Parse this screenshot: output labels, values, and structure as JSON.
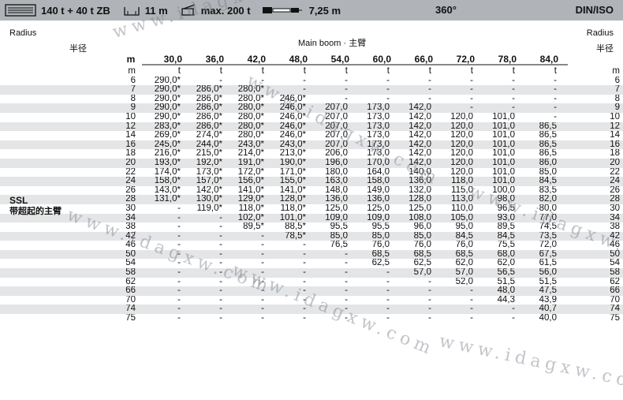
{
  "topbar": {
    "counterweight": "140 t + 40 t ZB",
    "radius": "11 m",
    "capacity": "max. 200 t",
    "width": "7,25 m",
    "slew": "360°",
    "standard": "DIN/ISO"
  },
  "header": {
    "radius_left_en": "Radius",
    "radius_left_cn": "半径",
    "main_boom": "Main boom · 主臂",
    "radius_right_en": "Radius",
    "radius_right_cn": "半径",
    "m_label": "m",
    "unit_m": "m",
    "unit_t": "t",
    "boom_lengths": [
      "30,0",
      "36,0",
      "42,0",
      "48,0",
      "54,0",
      "60,0",
      "66,0",
      "72,0",
      "78,0",
      "84,0"
    ]
  },
  "config": {
    "code": "SSL",
    "desc_cn": "带超起的主臂"
  },
  "watermark": "www.idagxw.com",
  "rows": [
    {
      "r": "6",
      "v": [
        "290,0*",
        "-",
        "-",
        "-",
        "-",
        "-",
        "-",
        "-",
        "-",
        "-"
      ]
    },
    {
      "r": "7",
      "v": [
        "290,0*",
        "286,0*",
        "280,0*",
        "-",
        "-",
        "-",
        "-",
        "-",
        "-",
        "-"
      ]
    },
    {
      "r": "8",
      "v": [
        "290,0*",
        "286,0*",
        "280,0*",
        "246,0*",
        "-",
        "-",
        "-",
        "-",
        "-",
        "-"
      ]
    },
    {
      "r": "9",
      "v": [
        "290,0*",
        "286,0*",
        "280,0*",
        "246,0*",
        "207,0",
        "173,0",
        "142,0",
        "-",
        "-",
        "-"
      ]
    },
    {
      "r": "10",
      "v": [
        "290,0*",
        "286,0*",
        "280,0*",
        "246,0*",
        "207,0",
        "173,0",
        "142,0",
        "120,0",
        "101,0",
        "-"
      ]
    },
    {
      "r": "12",
      "v": [
        "283,0*",
        "286,0*",
        "280,0*",
        "246,0*",
        "207,0",
        "173,0",
        "142,0",
        "120,0",
        "101,0",
        "86,5"
      ]
    },
    {
      "r": "14",
      "v": [
        "269,0*",
        "274,0*",
        "280,0*",
        "246,0*",
        "207,0",
        "173,0",
        "142,0",
        "120,0",
        "101,0",
        "86,5"
      ]
    },
    {
      "r": "16",
      "v": [
        "245,0*",
        "244,0*",
        "243,0*",
        "243,0*",
        "207,0",
        "173,0",
        "142,0",
        "120,0",
        "101,0",
        "86,5"
      ]
    },
    {
      "r": "18",
      "v": [
        "216,0*",
        "215,0*",
        "214,0*",
        "213,0*",
        "206,0",
        "173,0",
        "142,0",
        "120,0",
        "101,0",
        "86,5"
      ]
    },
    {
      "r": "20",
      "v": [
        "193,0*",
        "192,0*",
        "191,0*",
        "190,0*",
        "196,0",
        "170,0",
        "142,0",
        "120,0",
        "101,0",
        "86,0"
      ]
    },
    {
      "r": "22",
      "v": [
        "174,0*",
        "173,0*",
        "172,0*",
        "171,0*",
        "180,0",
        "164,0",
        "140,0",
        "120,0",
        "101,0",
        "85,0"
      ]
    },
    {
      "r": "24",
      "v": [
        "158,0*",
        "157,0*",
        "156,0*",
        "155,0*",
        "163,0",
        "158,0",
        "136,0",
        "118,0",
        "101,0",
        "84,5"
      ]
    },
    {
      "r": "26",
      "v": [
        "143,0*",
        "142,0*",
        "141,0*",
        "141,0*",
        "148,0",
        "149,0",
        "132,0",
        "115,0",
        "100,0",
        "83,5"
      ]
    },
    {
      "r": "28",
      "v": [
        "131,0*",
        "130,0*",
        "129,0*",
        "128,0*",
        "136,0",
        "136,0",
        "128,0",
        "113,0",
        "98,0",
        "82,0"
      ]
    },
    {
      "r": "30",
      "v": [
        "-",
        "119,0*",
        "118,0*",
        "118,0*",
        "125,0",
        "125,0",
        "125,0",
        "110,0",
        "96,5",
        "80,0"
      ]
    },
    {
      "r": "34",
      "v": [
        "-",
        "-",
        "102,0*",
        "101,0*",
        "109,0",
        "109,0",
        "108,0",
        "105,0",
        "93,0",
        "77,0"
      ]
    },
    {
      "r": "38",
      "v": [
        "-",
        "-",
        "89,5*",
        "88,5*",
        "95,5",
        "95,5",
        "96,0",
        "95,0",
        "89,5",
        "74,5"
      ]
    },
    {
      "r": "42",
      "v": [
        "-",
        "-",
        "-",
        "78,5*",
        "85,0",
        "85,0",
        "85,0",
        "84,5",
        "84,5",
        "73,5"
      ]
    },
    {
      "r": "46",
      "v": [
        "-",
        "-",
        "-",
        "-",
        "76,5",
        "76,0",
        "76,0",
        "76,0",
        "75,5",
        "72,0"
      ]
    },
    {
      "r": "50",
      "v": [
        "-",
        "-",
        "-",
        "-",
        "-",
        "68,5",
        "68,5",
        "68,5",
        "68,0",
        "67,5"
      ]
    },
    {
      "r": "54",
      "v": [
        "-",
        "-",
        "-",
        "-",
        "-",
        "62,5",
        "62,5",
        "62,0",
        "62,0",
        "61,5"
      ]
    },
    {
      "r": "58",
      "v": [
        "-",
        "-",
        "-",
        "-",
        "-",
        "-",
        "57,0",
        "57,0",
        "56,5",
        "56,0"
      ]
    },
    {
      "r": "62",
      "v": [
        "-",
        "-",
        "-",
        "-",
        "-",
        "-",
        "-",
        "52,0",
        "51,5",
        "51,5"
      ]
    },
    {
      "r": "66",
      "v": [
        "-",
        "-",
        "-",
        "-",
        "-",
        "-",
        "-",
        "-",
        "48,0",
        "47,5"
      ]
    },
    {
      "r": "70",
      "v": [
        "-",
        "-",
        "-",
        "-",
        "-",
        "-",
        "-",
        "-",
        "44,3",
        "43,9"
      ]
    },
    {
      "r": "74",
      "v": [
        "-",
        "-",
        "-",
        "-",
        "-",
        "-",
        "-",
        "-",
        "-",
        "40,7"
      ]
    },
    {
      "r": "75",
      "v": [
        "-",
        "-",
        "-",
        "-",
        "-",
        "-",
        "-",
        "-",
        "-",
        "40,0"
      ]
    }
  ]
}
